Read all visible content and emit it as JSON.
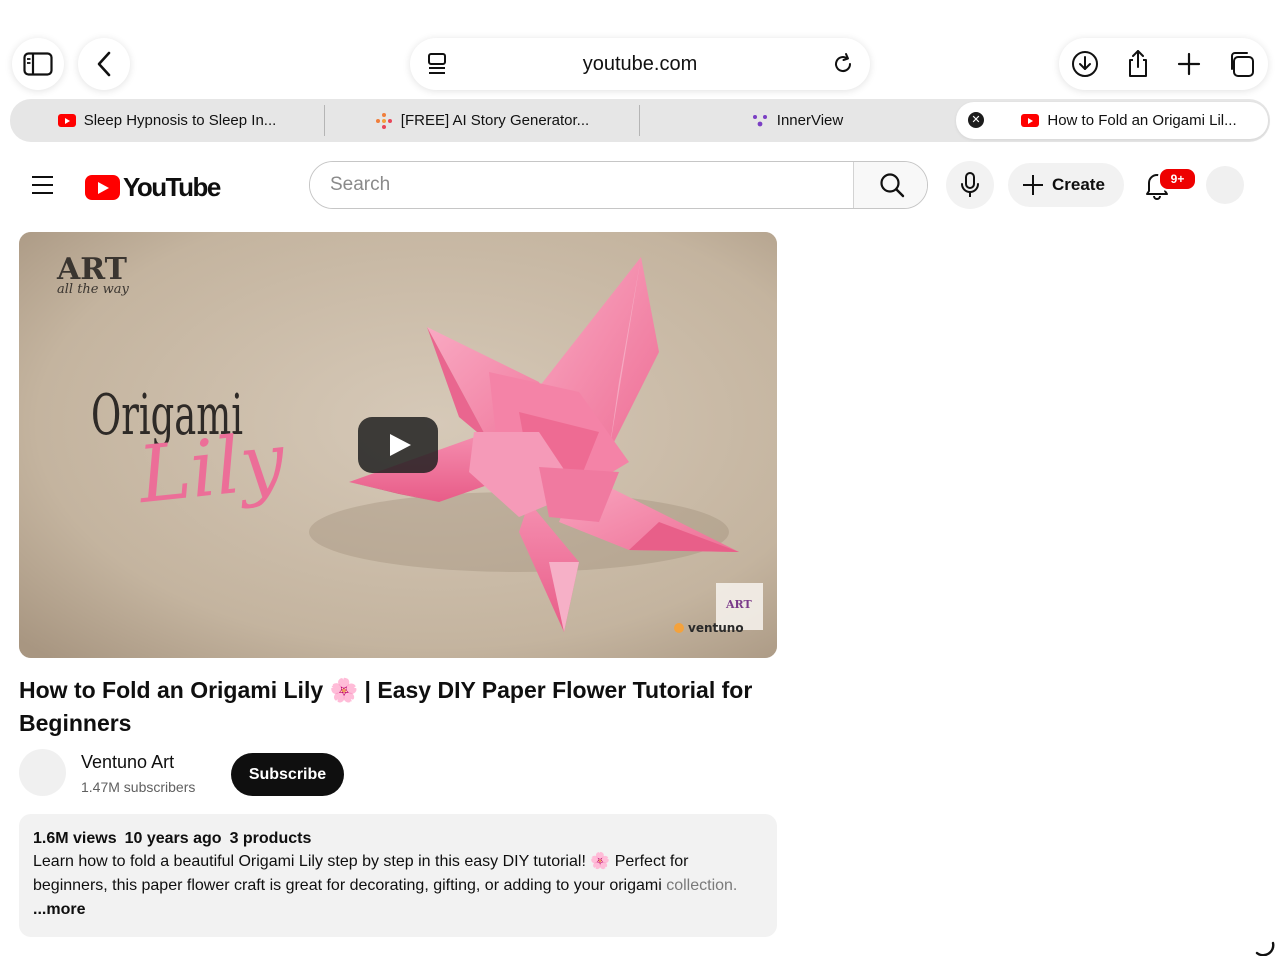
{
  "browser": {
    "url": "youtube.com",
    "tabs": [
      {
        "title": "Sleep Hypnosis to Sleep In...",
        "favicon": "youtube-icon"
      },
      {
        "title": "[FREE] AI Story Generator...",
        "favicon": "story-generator-icon"
      },
      {
        "title": "InnerView",
        "favicon": "innerview-icon"
      },
      {
        "title": "How to Fold an Origami Lil...",
        "favicon": "youtube-icon",
        "active": true
      }
    ]
  },
  "youtube": {
    "logo_text": "YouTube",
    "search_placeholder": "Search",
    "create_label": "Create",
    "notification_count": "9+"
  },
  "video": {
    "thumbnail_texts": {
      "art_logo": "ART",
      "art_tagline": "all the way",
      "title_main": "Origami",
      "title_script": "Lily",
      "watermark_brand": "ventuno"
    },
    "title": "How to Fold an Origami Lily 🌸 | Easy DIY Paper Flower Tutorial for Beginners",
    "channel_name": "Ventuno Art",
    "subscribers": "1.47M subscribers",
    "subscribe_label": "Subscribe",
    "views": "1.6M views",
    "age": "10 years ago",
    "products": "3 products",
    "description": "Learn how to fold a beautiful Origami Lily step by step in this easy DIY tutorial! 🌸 Perfect for beginners, this paper flower craft is great for decorating, gifting, or adding to your origami ",
    "description_fade": "collection.",
    "more_label": "...more"
  },
  "colors": {
    "youtube_red": "#ff0000",
    "subscribe_bg": "#0f0f0f",
    "lily_pink": "#f27aa0"
  }
}
